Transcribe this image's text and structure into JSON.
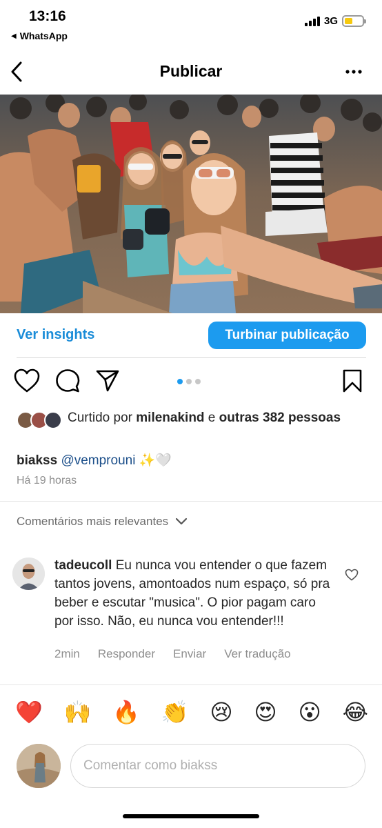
{
  "status": {
    "time": "13:16",
    "back_app": "WhatsApp",
    "network": "3G"
  },
  "header": {
    "title": "Publicar"
  },
  "actions": {
    "insights_label": "Ver insights",
    "boost_label": "Turbinar publicação"
  },
  "carousel": {
    "pages": 3,
    "current": 1
  },
  "likes": {
    "prefix": "Curtido por ",
    "user": "milenakind",
    "connector": " e ",
    "others": "outras 382 pessoas"
  },
  "caption": {
    "user": "biakss",
    "mention": "@vemprouni",
    "emojis": "✨🤍"
  },
  "time_ago": "Há 19 horas",
  "comments_filter": "Comentários mais relevantes",
  "comment": {
    "user": "tadeucoll",
    "text": "Eu nunca vou entender o que fazem tantos jovens, amontoados num espaço, só pra beber e escutar \"musica\". O pior pagam caro por isso. Não, eu nunca vou entender!!!",
    "time": "2min",
    "reply_label": "Responder",
    "send_label": "Enviar",
    "translate_label": "Ver tradução"
  },
  "quick_reactions": [
    "❤️",
    "🙌",
    "🔥",
    "👏",
    "😢",
    "😍",
    "😮",
    "😂"
  ],
  "composer": {
    "placeholder": "Comentar como biakss"
  },
  "colors": {
    "accent": "#1c9bef",
    "link": "#1a8cd8",
    "muted": "#8e8e8e"
  }
}
